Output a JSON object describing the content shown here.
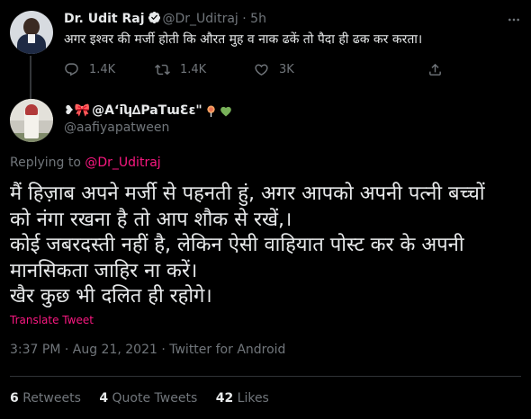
{
  "quoted_tweet": {
    "author_name": "Dr. Udit Raj",
    "author_handle": "@Dr_Uditraj",
    "separator": "·",
    "time": "5h",
    "text": "अगर इश्वर की मर्जी होती कि औरत मुह व नाक ढकें तो पैदा ही ढक कर  करता।",
    "replies": "1.4K",
    "retweets": "1.4K",
    "likes": "3K"
  },
  "main_tweet": {
    "author_name_prefix": "❥🎀",
    "author_name": "@Aʻiʮ∆PaTɯƐɛ\"",
    "author_handle": "@aafiyapatween",
    "replying_prefix": "Replying to",
    "replying_to": "@Dr_Uditraj",
    "text_lines": [
      "मैं हिज़ाब अपने मर्जी से पहनती हुं, अगर आपको अपनी पत्नी बच्चों",
      "को नंगा रखना है तो आप शौक से रखें,।",
      "कोई जबरदस्ती नहीं है, लेकिन ऐसी वाहियात पोस्ट कर के अपनी",
      "मानसिकता जाहिर ना करें।",
      "खैर कुछ भी दलित ही रहोगे।"
    ],
    "translate_label": "Translate Tweet",
    "timestamp": "3:37 PM · Aug 21, 2021 · Twitter for Android",
    "stats": {
      "retweets_count": "6",
      "retweets_label": "Retweets",
      "quotes_count": "4",
      "quotes_label": "Quote Tweets",
      "likes_count": "42",
      "likes_label": "Likes"
    }
  },
  "icons": {
    "verified": "verified-badge-icon",
    "more": "more-icon",
    "reply": "reply-icon",
    "retweet": "retweet-icon",
    "like": "heart-icon",
    "share": "share-icon"
  },
  "colors": {
    "background": "#000000",
    "text_primary": "#e7e9ea",
    "text_secondary": "#71767b",
    "accent_pink": "#f91880",
    "divider": "#2f3336"
  }
}
